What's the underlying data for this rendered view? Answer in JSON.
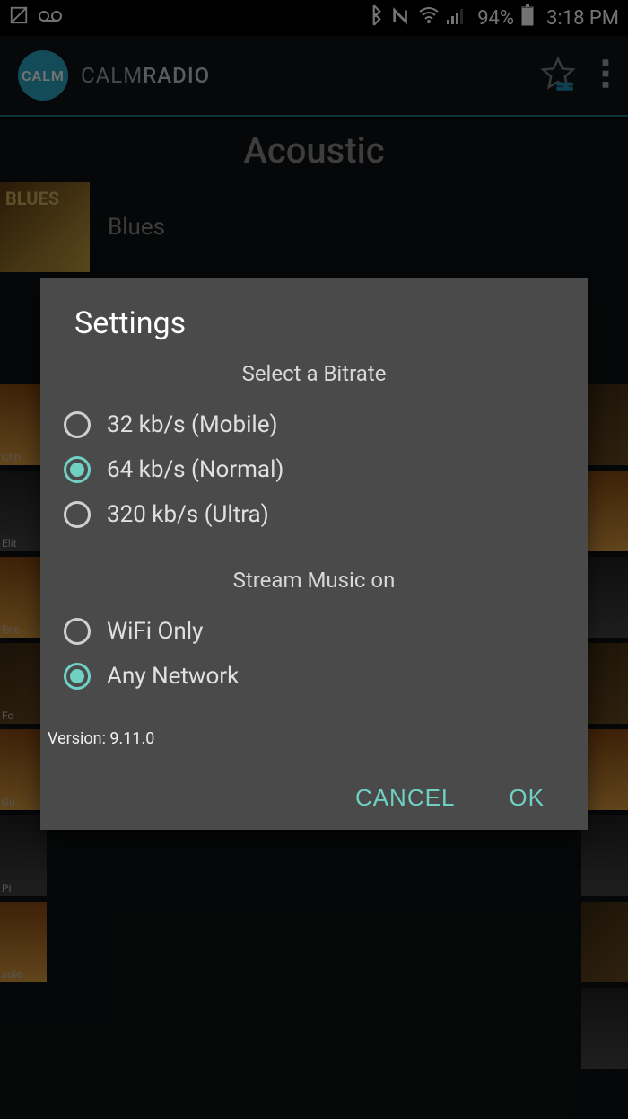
{
  "status_bar": {
    "battery_text": "94%",
    "clock": "3:18 PM"
  },
  "header": {
    "logo_text": "CALM",
    "brand_light": "CALM",
    "brand_bold": "RADIO"
  },
  "page": {
    "category": "Acoustic",
    "station_label": "Blues"
  },
  "dialog": {
    "title": "Settings",
    "bitrate_section": "Select a Bitrate",
    "bitrate_options": [
      {
        "label": "32 kb/s (Mobile)",
        "selected": false
      },
      {
        "label": "64 kb/s (Normal)",
        "selected": true
      },
      {
        "label": "320 kb/s (Ultra)",
        "selected": false
      }
    ],
    "stream_section": "Stream Music on",
    "stream_options": [
      {
        "label": "WiFi Only",
        "selected": false
      },
      {
        "label": "Any Network",
        "selected": true
      }
    ],
    "version": "Version: 9.11.0",
    "cancel": "CANCEL",
    "ok": "OK"
  }
}
